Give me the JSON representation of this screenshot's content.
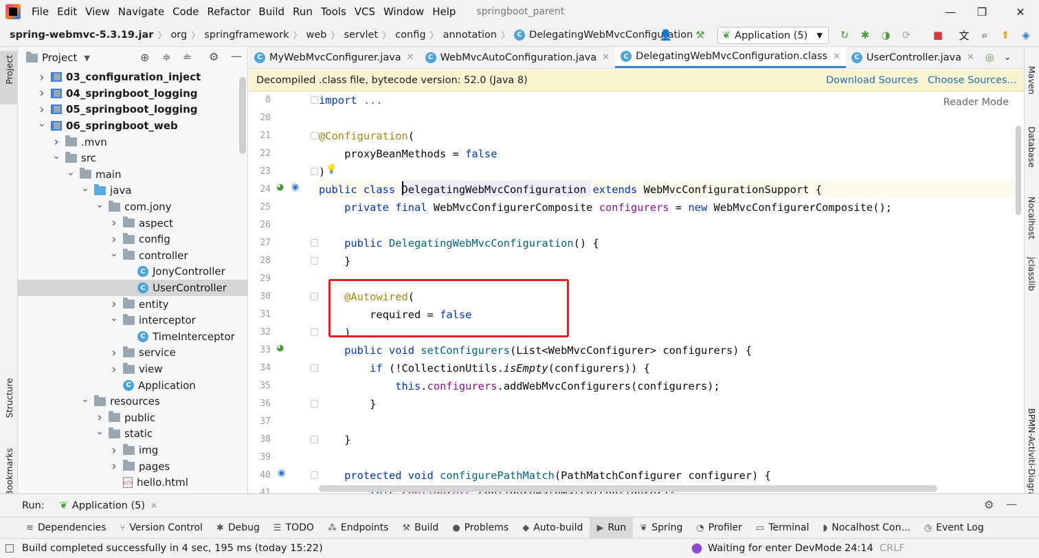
{
  "menu": {
    "items": [
      "File",
      "Edit",
      "View",
      "Navigate",
      "Code",
      "Refactor",
      "Build",
      "Run",
      "Tools",
      "VCS",
      "Window",
      "Help"
    ],
    "project_title": "springboot_parent"
  },
  "breadcrumb": [
    "spring-webmvc-5.3.19.jar",
    "org",
    "springframework",
    "web",
    "servlet",
    "config",
    "annotation",
    "DelegatingWebMvcConfiguration"
  ],
  "toolbar": {
    "run_config": "Application (5)"
  },
  "left_strip": {
    "project": "Project",
    "structure": "Structure",
    "bookmarks": "Bookmarks"
  },
  "right_strip": {
    "maven": "Maven",
    "database": "Database",
    "nocalhost": "Nocalhost",
    "jclasslib": "jclasslib",
    "bpmn": "BPMN-Activiti-Diagram"
  },
  "project_panel": {
    "title": "Project",
    "tree": [
      {
        "label": "03_configuration_inject",
        "depth": 1,
        "icon": "module",
        "arrow": "right",
        "bold": true
      },
      {
        "label": "04_springboot_logging",
        "depth": 1,
        "icon": "module",
        "arrow": "right",
        "bold": true
      },
      {
        "label": "05_springboot_logging",
        "depth": 1,
        "icon": "module",
        "arrow": "right",
        "bold": true
      },
      {
        "label": "06_springboot_web",
        "depth": 1,
        "icon": "module",
        "arrow": "down",
        "bold": true
      },
      {
        "label": ".mvn",
        "depth": 2,
        "icon": "folder",
        "arrow": "right"
      },
      {
        "label": "src",
        "depth": 2,
        "icon": "folder",
        "arrow": "down"
      },
      {
        "label": "main",
        "depth": 3,
        "icon": "folder",
        "arrow": "down"
      },
      {
        "label": "java",
        "depth": 4,
        "icon": "folder-blue",
        "arrow": "down"
      },
      {
        "label": "com.jony",
        "depth": 5,
        "icon": "folder",
        "arrow": "down"
      },
      {
        "label": "aspect",
        "depth": 6,
        "icon": "folder",
        "arrow": "right"
      },
      {
        "label": "config",
        "depth": 6,
        "icon": "folder",
        "arrow": "right"
      },
      {
        "label": "controller",
        "depth": 6,
        "icon": "folder",
        "arrow": "down"
      },
      {
        "label": "JonyController",
        "depth": 7,
        "icon": "class"
      },
      {
        "label": "UserController",
        "depth": 7,
        "icon": "class",
        "selected": true
      },
      {
        "label": "entity",
        "depth": 6,
        "icon": "folder",
        "arrow": "right"
      },
      {
        "label": "interceptor",
        "depth": 6,
        "icon": "folder",
        "arrow": "down"
      },
      {
        "label": "TimeInterceptor",
        "depth": 7,
        "icon": "class"
      },
      {
        "label": "service",
        "depth": 6,
        "icon": "folder",
        "arrow": "right"
      },
      {
        "label": "view",
        "depth": 6,
        "icon": "folder",
        "arrow": "right"
      },
      {
        "label": "Application",
        "depth": 6,
        "icon": "class"
      },
      {
        "label": "resources",
        "depth": 4,
        "icon": "folder",
        "arrow": "down"
      },
      {
        "label": "public",
        "depth": 5,
        "icon": "folder",
        "arrow": "right"
      },
      {
        "label": "static",
        "depth": 5,
        "icon": "folder",
        "arrow": "down"
      },
      {
        "label": "img",
        "depth": 6,
        "icon": "folder",
        "arrow": "right"
      },
      {
        "label": "pages",
        "depth": 6,
        "icon": "folder",
        "arrow": "right"
      },
      {
        "label": "hello.html",
        "depth": 6,
        "icon": "html"
      }
    ]
  },
  "editor_tabs": [
    {
      "label": "MyWebMvcConfigurer.java",
      "active": false
    },
    {
      "label": "WebMvcAutoConfiguration.java",
      "active": false
    },
    {
      "label": "DelegatingWebMvcConfiguration.class",
      "active": true
    },
    {
      "label": "UserController.java",
      "active": false
    }
  ],
  "banner": {
    "text": "Decompiled .class file, bytecode version: 52.0 (Java 8)",
    "download_sources": "Download Sources",
    "choose_sources": "Choose Sources..."
  },
  "editor": {
    "reader_mode": "Reader Mode",
    "lines": [
      {
        "n": "8",
        "tokens": [
          [
            "kw",
            "import "
          ],
          [
            "gray",
            "..."
          ]
        ]
      },
      {
        "n": "20",
        "tokens": []
      },
      {
        "n": "21",
        "tokens": [
          [
            "ann",
            "@Configuration"
          ],
          [
            "",
            "("
          ]
        ]
      },
      {
        "n": "22",
        "tokens": [
          [
            "",
            "    proxyBeanMethods = "
          ],
          [
            "lit",
            "false"
          ]
        ]
      },
      {
        "n": "23",
        "tokens": [
          [
            "",
            ")"
          ]
        ]
      },
      {
        "n": "24",
        "tokens": [
          [
            "kw",
            "public class "
          ],
          [
            "",
            "DelegatingWebMvcConfiguration "
          ],
          [
            "kw",
            "extends "
          ],
          [
            "",
            "WebMvcConfigurationSupport {"
          ]
        ]
      },
      {
        "n": "25",
        "tokens": [
          [
            "kw",
            "    private final "
          ],
          [
            "",
            "WebMvcConfigurerComposite "
          ],
          [
            "fld",
            "configurers"
          ],
          [
            "",
            " = "
          ],
          [
            "kw",
            "new "
          ],
          [
            "",
            "WebMvcConfigurerComposite();"
          ]
        ]
      },
      {
        "n": "26",
        "tokens": []
      },
      {
        "n": "27",
        "tokens": [
          [
            "kw",
            "    public "
          ],
          [
            "mth",
            "DelegatingWebMvcConfiguration"
          ],
          [
            "",
            "() {"
          ]
        ]
      },
      {
        "n": "28",
        "tokens": [
          [
            "",
            "    }"
          ]
        ]
      },
      {
        "n": "29",
        "tokens": []
      },
      {
        "n": "30",
        "tokens": [
          [
            "ann",
            "    @Autowired"
          ],
          [
            "",
            "("
          ]
        ]
      },
      {
        "n": "31",
        "tokens": [
          [
            "",
            "        required = "
          ],
          [
            "lit",
            "false"
          ]
        ]
      },
      {
        "n": "32",
        "tokens": [
          [
            "",
            "    )"
          ]
        ]
      },
      {
        "n": "33",
        "tokens": [
          [
            "kw",
            "    public void "
          ],
          [
            "mth",
            "setConfigurers"
          ],
          [
            "",
            "(List<WebMvcConfigurer> configurers) {"
          ]
        ]
      },
      {
        "n": "34",
        "tokens": [
          [
            "kw",
            "        if "
          ],
          [
            "",
            "(!CollectionUtils."
          ],
          [
            "it",
            "isEmpty"
          ],
          [
            "",
            "(configurers)) {"
          ]
        ]
      },
      {
        "n": "35",
        "tokens": [
          [
            "kw",
            "            this"
          ],
          [
            "",
            "."
          ],
          [
            "fld",
            "configurers"
          ],
          [
            "",
            ".addWebMvcConfigurers(configurers);"
          ]
        ]
      },
      {
        "n": "36",
        "tokens": [
          [
            "",
            "        }"
          ]
        ]
      },
      {
        "n": "37",
        "tokens": []
      },
      {
        "n": "38",
        "tokens": [
          [
            "",
            "    }"
          ]
        ]
      },
      {
        "n": "39",
        "tokens": []
      },
      {
        "n": "40",
        "tokens": [
          [
            "kw",
            "    protected void "
          ],
          [
            "mth",
            "configurePathMatch"
          ],
          [
            "",
            "(PathMatchConfigurer configurer) {"
          ]
        ]
      },
      {
        "n": "41",
        "tokens": [
          [
            "kw",
            "        this"
          ],
          [
            "",
            "."
          ],
          [
            "fld",
            "configurers"
          ],
          [
            "",
            ".configurePathMatch(configurer);"
          ]
        ]
      }
    ]
  },
  "run_bar": {
    "label": "Run:",
    "tab": "Application (5)"
  },
  "tool_windows": [
    {
      "label": "Dependencies",
      "glyph": "≋"
    },
    {
      "label": "Version Control",
      "glyph": "⑂"
    },
    {
      "label": "Debug",
      "glyph": "✱"
    },
    {
      "label": "TODO",
      "glyph": "☰"
    },
    {
      "label": "Endpoints",
      "glyph": "⁂"
    },
    {
      "label": "Build",
      "glyph": "⚒"
    },
    {
      "label": "Problems",
      "glyph": "●"
    },
    {
      "label": "Auto-build",
      "glyph": "◆"
    },
    {
      "label": "Run",
      "glyph": "▶",
      "active": true
    },
    {
      "label": "Spring",
      "glyph": "❦"
    },
    {
      "label": "Profiler",
      "glyph": "◔"
    },
    {
      "label": "Terminal",
      "glyph": "▭"
    },
    {
      "label": "Nocalhost Con...",
      "glyph": "◗"
    },
    {
      "label": "Event Log",
      "glyph": "◷"
    }
  ],
  "status": {
    "message": "Build completed successfully in 4 sec, 195 ms (today 15:22)",
    "devmode": "Waiting for enter DevMode",
    "position": "24:14",
    "line_sep": "CRLF"
  },
  "colors": {
    "accent": "#3b82c4",
    "highlight_box": "#e02020",
    "banner_bg": "#f8f4d2"
  }
}
